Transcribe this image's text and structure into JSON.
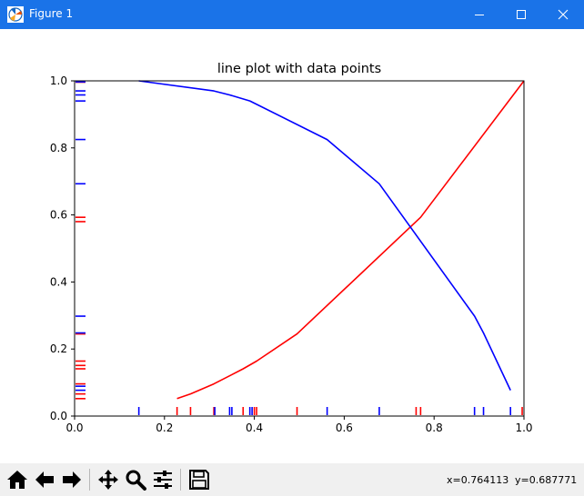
{
  "window": {
    "title": "Figure 1",
    "controls": [
      "minimize-icon",
      "maximize-icon",
      "close-icon"
    ],
    "titlebar_color": "#1a73e8"
  },
  "toolbar": {
    "buttons": [
      "home-icon",
      "back-icon",
      "forward-icon",
      "pan-icon",
      "zoom-icon",
      "configure-subplots-icon",
      "save-icon"
    ],
    "coord_x": "x=0.764113",
    "coord_y": "y=0.687771"
  },
  "chart_data": {
    "type": "line",
    "title": "line plot with data points",
    "xlabel": "",
    "ylabel": "",
    "xlim": [
      0.0,
      1.0
    ],
    "ylim": [
      0.0,
      1.0
    ],
    "xticks": [
      "0.0",
      "0.2",
      "0.4",
      "0.6",
      "0.8",
      "1.0"
    ],
    "yticks": [
      "0.0",
      "0.2",
      "0.4",
      "0.6",
      "0.8",
      "1.0"
    ],
    "grid": false,
    "series": [
      {
        "color": "#ff0000",
        "x": [
          0.228,
          0.258,
          0.31,
          0.375,
          0.405,
          0.495,
          0.77,
          1.0
        ],
        "y": [
          0.052,
          0.066,
          0.096,
          0.141,
          0.164,
          0.245,
          0.593,
          1.0
        ],
        "rug_x": [
          0.228,
          0.258,
          0.31,
          0.375,
          0.4,
          0.405,
          0.495,
          0.76,
          0.77,
          0.996
        ],
        "rug_y": [
          0.052,
          0.066,
          0.096,
          0.141,
          0.151,
          0.164,
          0.245,
          0.58,
          0.593,
          0.996
        ]
      },
      {
        "color": "#0000ff",
        "x": [
          0.143,
          0.31,
          0.345,
          0.39,
          0.562,
          0.678,
          0.89,
          0.91,
          0.97
        ],
        "y": [
          1.0,
          0.97,
          0.958,
          0.94,
          0.825,
          0.693,
          0.298,
          0.248,
          0.077
        ],
        "rug_x": [
          0.143,
          0.312,
          0.345,
          0.35,
          0.39,
          0.395,
          0.562,
          0.678,
          0.89,
          0.91,
          0.97
        ],
        "rug_y": [
          0.077,
          0.089,
          0.248,
          0.298,
          0.693,
          0.825,
          0.94,
          0.958,
          0.97,
          0.997
        ]
      }
    ]
  }
}
